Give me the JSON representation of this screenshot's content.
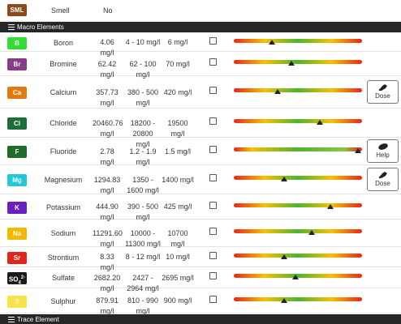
{
  "smell_row": {
    "code": "SML",
    "label": "Smell",
    "value": "No",
    "color": "#8a4a1c"
  },
  "sections": {
    "macro": "Macro Elements",
    "trace": "Trace Element"
  },
  "colors": {
    "section_bg": "#262626",
    "bar_red": "#e8241c",
    "bar_yellow": "#f5c200",
    "bar_green": "#4cb32e"
  },
  "elements": [
    {
      "code": "B",
      "name": "Boron",
      "value": "4.06 mg/l",
      "range": "4 - 10 mg/l",
      "target": "6 mg/l",
      "color": "#33dd33",
      "level": 0.3,
      "button": null
    },
    {
      "code": "Br",
      "name": "Bromine",
      "value": "62.42 mg/l",
      "range": "62 - 100 mg/l",
      "target": "70 mg/l",
      "color": "#8a3b86",
      "level": 0.45,
      "button": null
    },
    {
      "code": "Ca",
      "name": "Calcium",
      "value": "357.73 mg/l",
      "range": "380 - 500 mg/l",
      "target": "420 mg/l",
      "color": "#e07b10",
      "level": 0.34,
      "button": "Dose"
    },
    {
      "code": "Cl",
      "name": "Chloride",
      "value": "20460.76 mg/l",
      "range": "18200 - 20800 mg/l",
      "target": "19500 mg/l",
      "color": "#1e6e38",
      "level": 0.67,
      "button": null
    },
    {
      "code": "F",
      "name": "Fluoride",
      "value": "2.78 mg/l",
      "range": "1.2 - 1.9 mg/l",
      "target": "1.5 mg/l",
      "color": "#236b2a",
      "level": 0.97,
      "button": "Help"
    },
    {
      "code": "Mg",
      "name": "Magnesium",
      "value": "1294.83 mg/l",
      "range": "1350 - 1600 mg/l",
      "target": "1400 mg/l",
      "color": "#22c8d8",
      "level": 0.39,
      "button": "Dose"
    },
    {
      "code": "K",
      "name": "Potassium",
      "value": "444.90 mg/l",
      "range": "390 - 500 mg/l",
      "target": "425 mg/l",
      "color": "#6a1fc0",
      "level": 0.75,
      "button": null
    },
    {
      "code": "Na",
      "name": "Sodium",
      "value": "11291.60 mg/l",
      "range": "10000 - 11300 mg/l",
      "target": "10700 mg/l",
      "color": "#f5b800",
      "level": 0.61,
      "button": null
    },
    {
      "code": "Sr",
      "name": "Strontium",
      "value": "8.33 mg/l",
      "range": "8 - 12 mg/l",
      "target": "10 mg/l",
      "color": "#e0261c",
      "level": 0.39,
      "button": null
    },
    {
      "code": "SO4",
      "name": "Sulfate",
      "value": "2682.20 mg/l",
      "range": "2427 - 2964 mg/l",
      "target": "2695 mg/l",
      "color": "#1a1a1a",
      "level": 0.48,
      "button": null
    },
    {
      "code": "S",
      "name": "Sulphur",
      "value": "879.91 mg/l",
      "range": "810 - 990 mg/l",
      "target": "900 mg/l",
      "color": "#f7e34a",
      "level": 0.39,
      "button": null
    }
  ]
}
